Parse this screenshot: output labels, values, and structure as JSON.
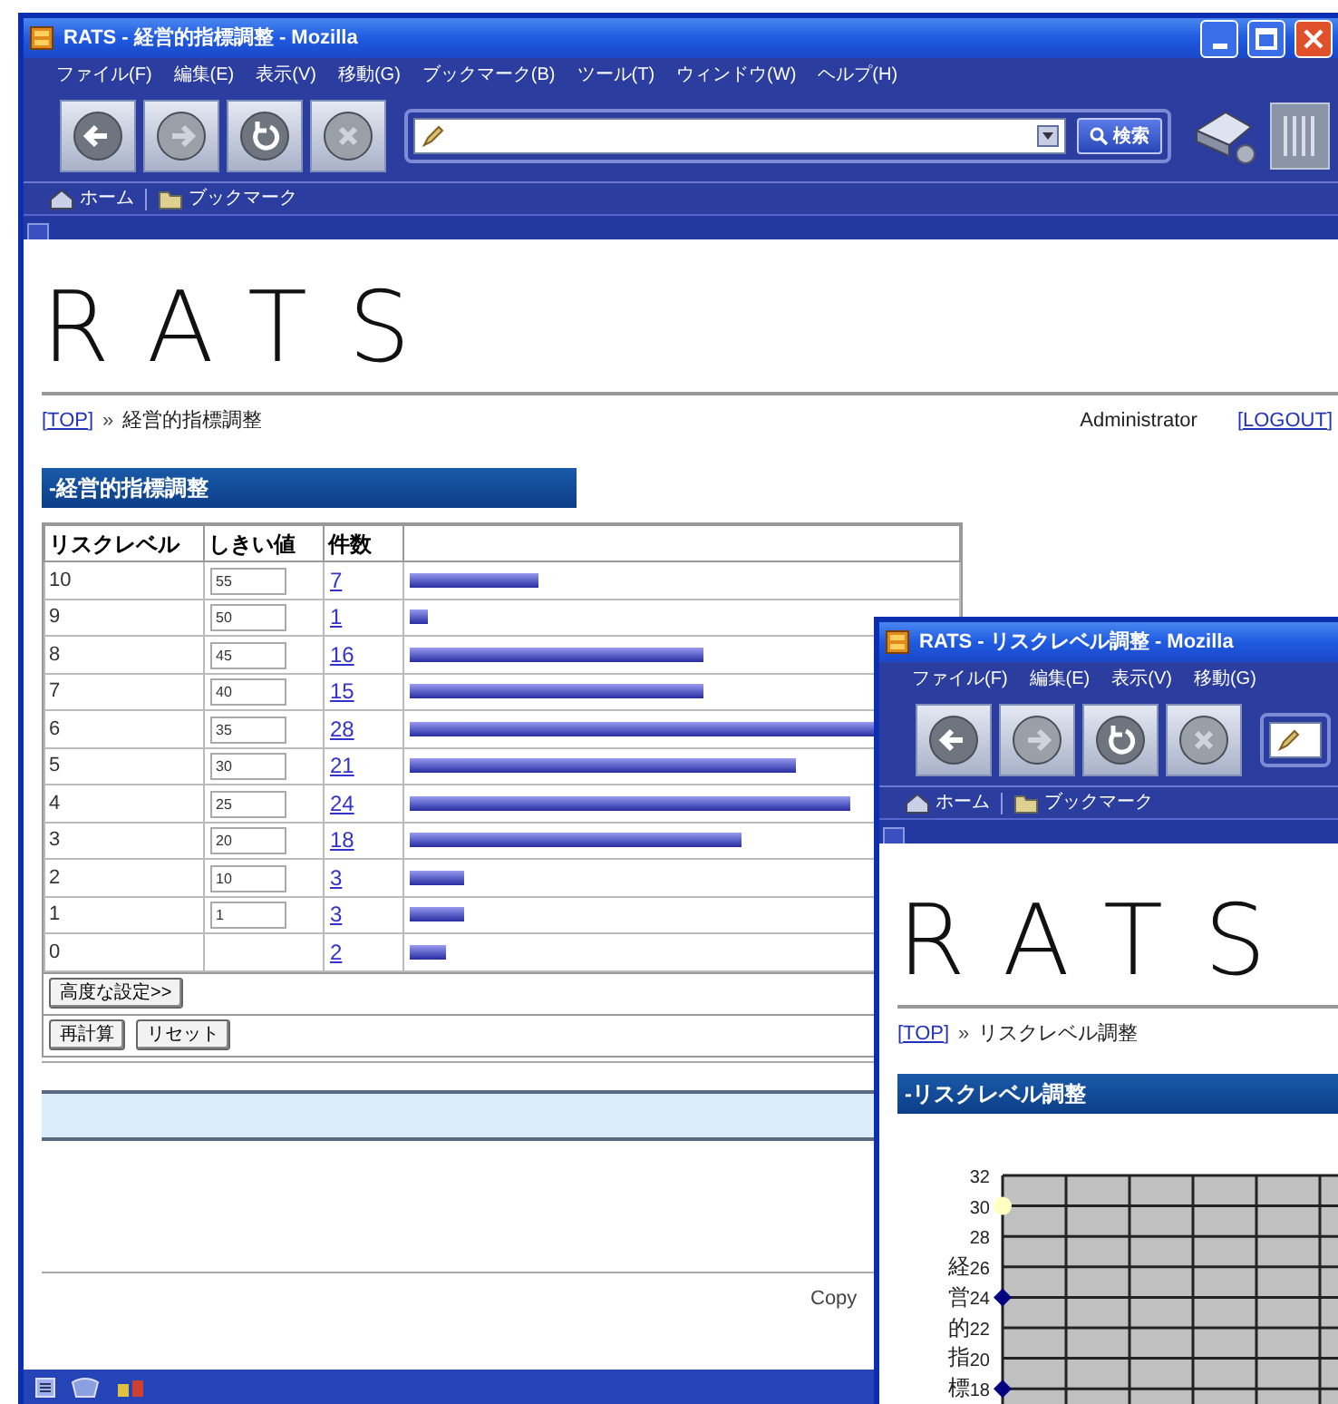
{
  "main_window": {
    "title": "RATS - 経営的指標調整 - Mozilla",
    "menu": [
      "ファイル(F)",
      "編集(E)",
      "表示(V)",
      "移動(G)",
      "ブックマーク(B)",
      "ツール(T)",
      "ウィンドウ(W)",
      "ヘルプ(H)"
    ],
    "search_button": "検索",
    "bookmarks": [
      "ホーム",
      "ブックマーク"
    ],
    "page": {
      "logo": "RATS",
      "breadcrumb_link": "[TOP]",
      "breadcrumb_separator": "»",
      "breadcrumb_current": "経営的指標調整",
      "user": "Administrator",
      "logout": "[LOGOUT]",
      "section_title": "-経営的指標調整",
      "columns": [
        "リスクレベル",
        "しきい値",
        "件数"
      ],
      "rows": [
        {
          "level_value": "10",
          "threshold": "55",
          "count": "7",
          "level": 0.235
        },
        {
          "level_value": "9",
          "threshold": "50",
          "count": "1",
          "level": 0.034
        },
        {
          "level_value": "8",
          "threshold": "45",
          "count": "16",
          "level": 0.54
        },
        {
          "level_value": "7",
          "threshold": "40",
          "count": "15",
          "level": 0.54
        },
        {
          "level_value": "6",
          "threshold": "35",
          "count": "28",
          "level": 0.94
        },
        {
          "level_value": "5",
          "threshold": "30",
          "count": "21",
          "level": 0.71
        },
        {
          "level_value": "4",
          "threshold": "25",
          "count": "24",
          "level": 0.81
        },
        {
          "level_value": "3",
          "threshold": "20",
          "count": "18",
          "level": 0.61
        },
        {
          "level_value": "2",
          "threshold": "10",
          "count": "3",
          "level": 0.1
        },
        {
          "level_value": "1",
          "threshold": "1",
          "count": "3",
          "level": 0.1
        },
        {
          "level_value": "0",
          "count": "2",
          "level": 0.066
        }
      ],
      "advanced_button": "高度な設定>>",
      "buttons": [
        "再計算",
        "リセット"
      ],
      "footer": "Copy"
    }
  },
  "second_window": {
    "title": "RATS - リスクレベル調整 - Mozilla",
    "menu": [
      "ファイル(F)",
      "編集(E)",
      "表示(V)",
      "移動(G)"
    ],
    "bookmarks": [
      "ホーム",
      "ブックマーク"
    ],
    "page": {
      "logo": "RATS",
      "breadcrumb_link": "[TOP]",
      "breadcrumb_separator": "»",
      "breadcrumb_current": "リスクレベル調整",
      "section_title": "-リスクレベル調整",
      "chart": {
        "axis_label": "経営的指標",
        "tick_labels": [
          "32",
          "30",
          "28",
          "26",
          "24",
          "22",
          "20",
          "18"
        ]
      }
    }
  }
}
